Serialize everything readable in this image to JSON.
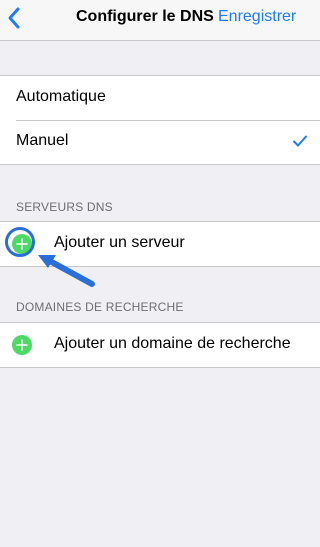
{
  "navbar": {
    "title": "Configurer le DNS",
    "save_label": "Enregistrer",
    "back_icon": "chevron-left-icon",
    "accent_color": "#1f7cf2"
  },
  "mode": {
    "options": [
      {
        "label": "Automatique",
        "selected": false
      },
      {
        "label": "Manuel",
        "selected": true
      }
    ]
  },
  "dns_servers": {
    "header": "SERVEURS DNS",
    "add_label": "Ajouter un serveur",
    "highlighted": true
  },
  "search_domains": {
    "header": "DOMAINES DE RECHERCHE",
    "add_label": "Ajouter un domaine de recherche"
  },
  "colors": {
    "add_green": "#4cd964",
    "annotation_blue": "#2a6fd8",
    "background": "#efeff4"
  }
}
